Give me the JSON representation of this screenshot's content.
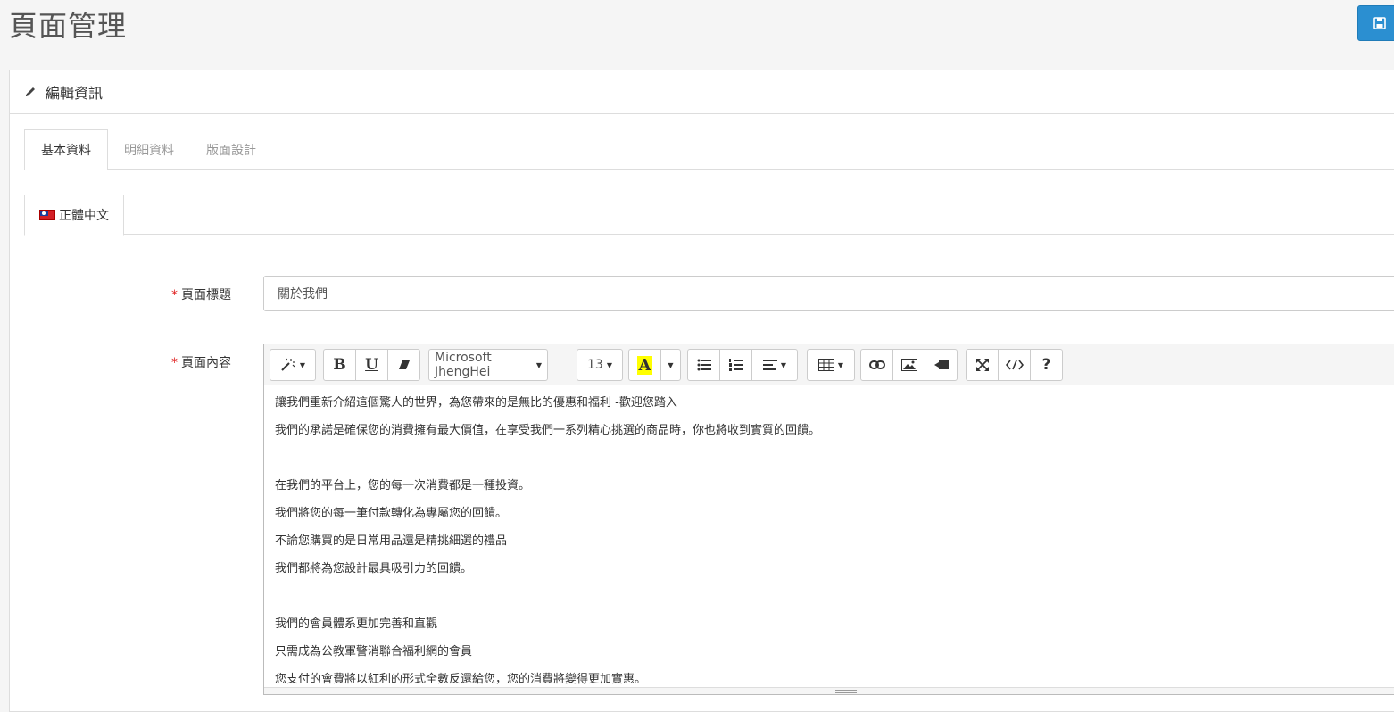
{
  "page": {
    "title": "頁面管理",
    "save_icon": "save-icon"
  },
  "panel": {
    "heading": "編輯資訊",
    "heading_icon": "pencil-icon"
  },
  "tabs": [
    {
      "label": "基本資料",
      "active": true
    },
    {
      "label": "明細資料",
      "active": false
    },
    {
      "label": "版面設計",
      "active": false
    }
  ],
  "lang_tab": {
    "label": "正體中文",
    "flag_icon": "taiwan-flag-icon"
  },
  "form": {
    "title_label": "頁面標題",
    "title_value": "關於我們",
    "content_label": "頁面內容",
    "required_mark": "*"
  },
  "toolbar": {
    "font_name": "Microsoft JhengHei",
    "font_size": "13",
    "help": "?"
  },
  "content_lines": [
    "讓我們重新介紹這個驚人的世界，為您帶來的是無比的優惠和福利 -歡迎您踏入",
    "我們的承諾是確保您的消費擁有最大價值，在享受我們一系列精心挑選的商品時，你也將收到實質的回饋。",
    "",
    "在我們的平台上，您的每一次消費都是一種投資。",
    "我們將您的每一筆付款轉化為專屬您的回饋。",
    "不論您購買的是日常用品還是精挑細選的禮品",
    "我們都將為您設計最具吸引力的回饋。",
    "",
    "我們的會員體系更加完善和直觀",
    "只需成為公教軍警消聯合福利網的會員",
    "您支付的會費將以紅利的形式全數反還給您，您的消費將變得更加實惠。"
  ],
  "colors": {
    "primary": "#2b8fd1",
    "required": "#e02222",
    "highlight": "#ffff00"
  }
}
